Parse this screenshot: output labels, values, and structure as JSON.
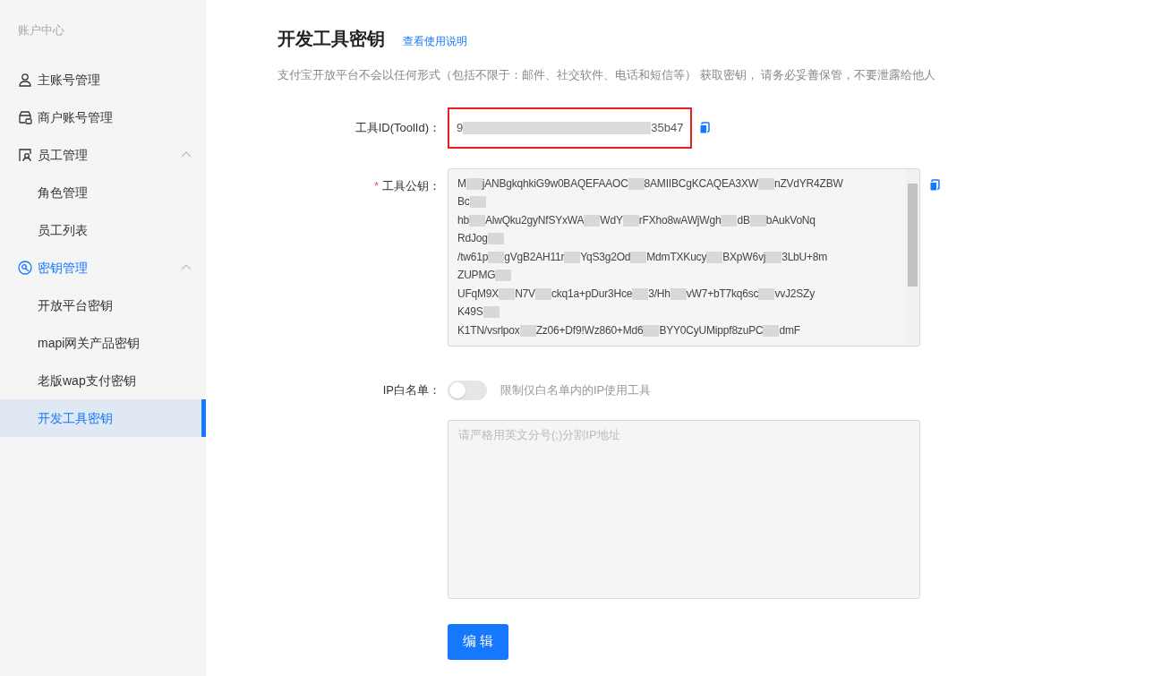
{
  "sidebar": {
    "title": "账户中心",
    "items": [
      {
        "label": "主账号管理",
        "active": false
      },
      {
        "label": "商户账号管理",
        "active": false
      },
      {
        "label": "员工管理",
        "active": false,
        "expanded": true,
        "children": [
          {
            "label": "角色管理",
            "selected": false
          },
          {
            "label": "员工列表",
            "selected": false
          }
        ]
      },
      {
        "label": "密钥管理",
        "active": true,
        "expanded": true,
        "children": [
          {
            "label": "开放平台密钥",
            "selected": false
          },
          {
            "label": "mapi网关产品密钥",
            "selected": false
          },
          {
            "label": "老版wap支付密钥",
            "selected": false
          },
          {
            "label": "开发工具密钥",
            "selected": true
          }
        ]
      }
    ]
  },
  "page": {
    "title": "开发工具密钥",
    "help_link": "查看使用说明",
    "notice": "支付宝开放平台不会以任何形式（包括不限于：邮件、社交软件、电话和短信等） 获取密钥， 请务必妥善保管，不要泄露给他人"
  },
  "tool_id": {
    "label": "工具ID(ToolId)：",
    "value_parts": [
      "9",
      "35b47"
    ],
    "highlighted": true
  },
  "public_key": {
    "label": "工具公钥：",
    "required_mark": "*",
    "lines": [
      [
        "M",
        "jANBgkqhkiG9w0BAQEFAAOC",
        "8AMIIBCgKCAQEA3XW",
        "nZVdYR4ZBW"
      ],
      [
        "Bc"
      ],
      [
        "hb",
        "AlwQku2gyNfSYxWA",
        "WdY",
        "rFXho8wAWjWgh",
        "dB",
        "bAukVoNq"
      ],
      [
        "RdJog"
      ],
      [
        "/tw61p",
        "gVgB2AH11r",
        "YqS3g2Od",
        "MdmTXKucy",
        "BXpW6vj",
        "3LbU+8m"
      ],
      [
        "ZUPMG"
      ],
      [
        "UFqM9X",
        "N7V",
        "ckq1a+pDur3Hce",
        "3/Hh",
        "vW7+bT7kq6sc",
        "vvJ2SZy"
      ],
      [
        "K49S"
      ],
      [
        "K1TN/vsrlpox",
        "Zz06+Df9!Wz860+Md6",
        "BYY0CyUMippf8zuPC",
        "dmF"
      ]
    ]
  },
  "ip_whitelist": {
    "label": "IP白名单：",
    "on": false,
    "hint": "限制仅白名单内的IP使用工具",
    "placeholder": "请严格用英文分号(;)分割IP地址"
  },
  "edit_button": "编 辑"
}
